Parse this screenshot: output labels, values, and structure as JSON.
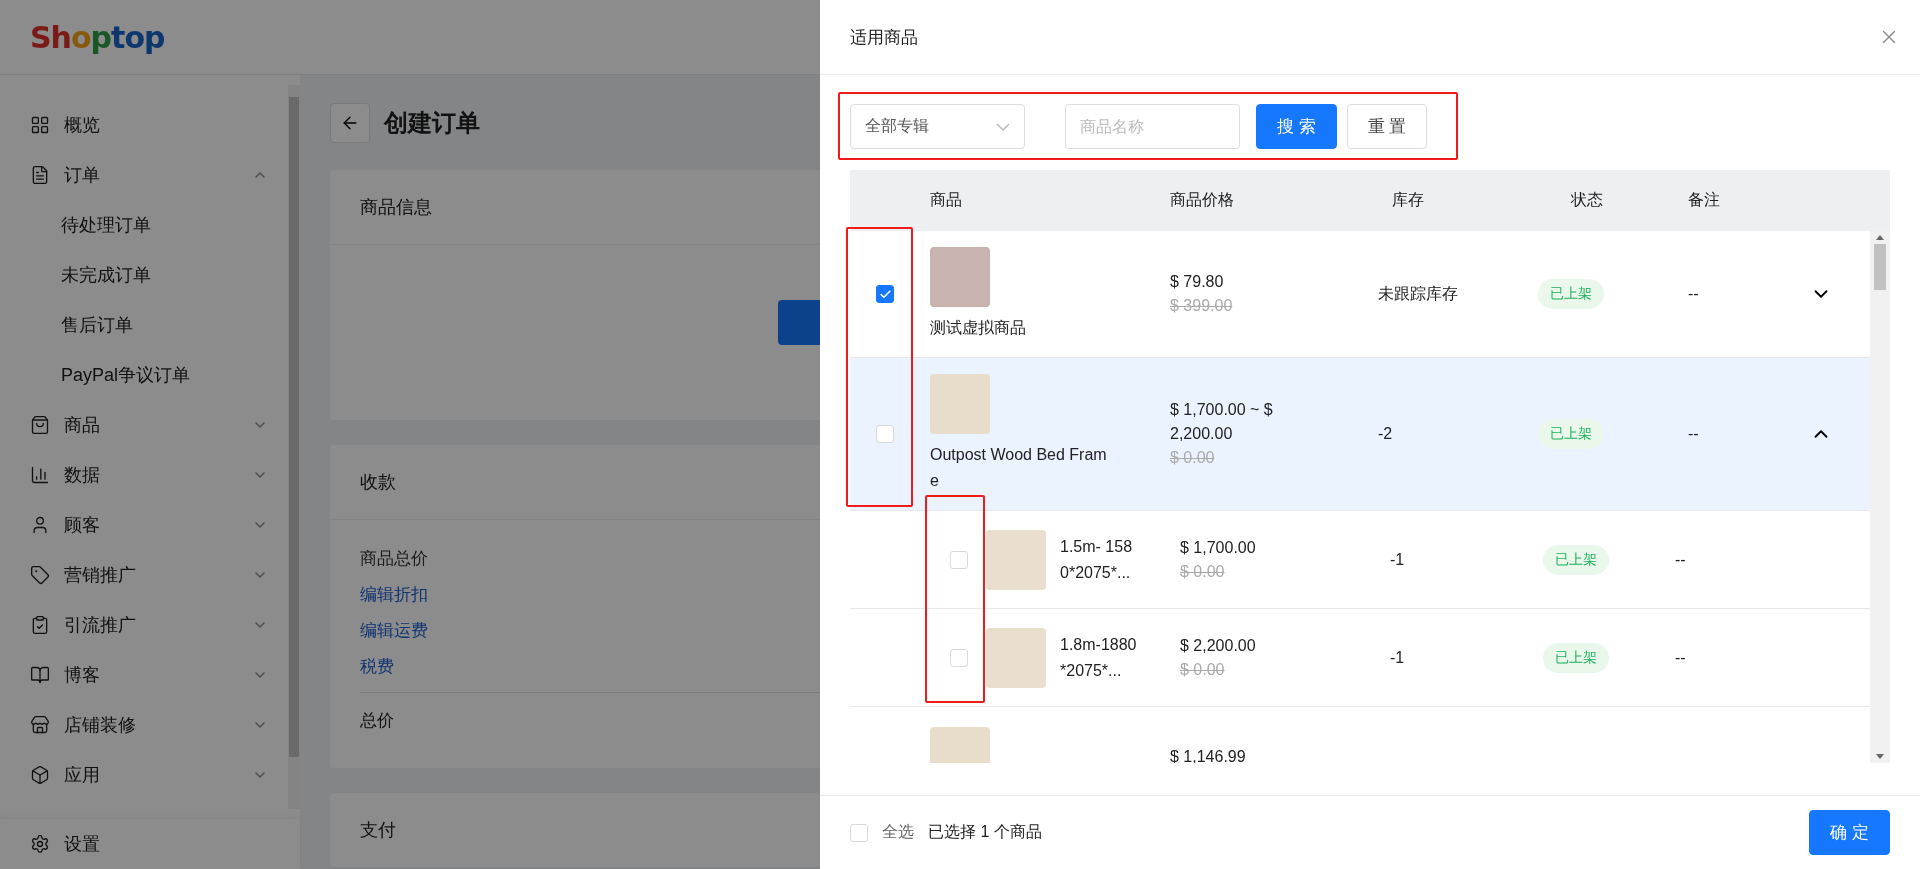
{
  "sidebar": {
    "logo": "Shoptop",
    "menu": [
      {
        "label": "概览"
      },
      {
        "label": "订单",
        "expanded": true,
        "children": [
          {
            "label": "待处理订单"
          },
          {
            "label": "未完成订单"
          },
          {
            "label": "售后订单"
          },
          {
            "label": "PayPal争议订单"
          }
        ]
      },
      {
        "label": "商品",
        "expanded": false
      },
      {
        "label": "数据",
        "expanded": false
      },
      {
        "label": "顾客",
        "expanded": false
      },
      {
        "label": "营销推广",
        "expanded": false
      },
      {
        "label": "引流推广",
        "expanded": false
      },
      {
        "label": "博客",
        "expanded": false
      },
      {
        "label": "店铺装修",
        "expanded": false
      },
      {
        "label": "应用",
        "expanded": false
      }
    ],
    "footer_item": "设置"
  },
  "main": {
    "title": "创建订单",
    "cards": [
      {
        "title": "商品信息",
        "kind": "product"
      },
      {
        "title": "收款",
        "kind": "summary",
        "lines": [
          {
            "label": "商品总价",
            "kind": "text"
          },
          {
            "label": "编辑折扣",
            "kind": "link"
          },
          {
            "label": "编辑运费",
            "kind": "link"
          },
          {
            "label": "税费",
            "kind": "link"
          }
        ],
        "total_label": "总价"
      },
      {
        "title": "支付",
        "kind": "plain"
      }
    ]
  },
  "drawer": {
    "title": "适用商品",
    "filters": {
      "collection_select": "全部专辑",
      "name_placeholder": "商品名称",
      "search_button": "搜 索",
      "reset_button": "重 置"
    },
    "table": {
      "columns": [
        "商品",
        "商品价格",
        "库存",
        "状态",
        "备注"
      ],
      "rows": [
        {
          "name": "测试虚拟商品",
          "price": "$ 79.80",
          "original_price": "$ 399.00",
          "stock": "未跟踪库存",
          "status": "已上架",
          "note": "--",
          "checked": true,
          "expanded": false,
          "highlighted": false
        },
        {
          "name": "Outpost Wood Bed Frame",
          "price": "$ 1,700.00 ~ $ 2,200.00",
          "original_price": "$ 0.00",
          "stock": "-2",
          "status": "已上架",
          "note": "--",
          "checked": false,
          "expanded": true,
          "highlighted": true,
          "children": [
            {
              "name": "1.5m- 1580*2075*...",
              "price": "$ 1,700.00",
              "original_price": "$ 0.00",
              "stock": "-1",
              "status": "已上架",
              "note": "--",
              "checked": false
            },
            {
              "name": "1.8m-1880*2075*...",
              "price": "$ 2,200.00",
              "original_price": "$ 0.00",
              "stock": "-1",
              "status": "已上架",
              "note": "--",
              "checked": false
            }
          ]
        },
        {
          "price": "$ 1,146.99"
        }
      ]
    },
    "footer": {
      "select_all_label": "全选",
      "select_all_checked": false,
      "selection_summary": "已选择 1 个商品",
      "confirm_button": "确 定"
    }
  }
}
